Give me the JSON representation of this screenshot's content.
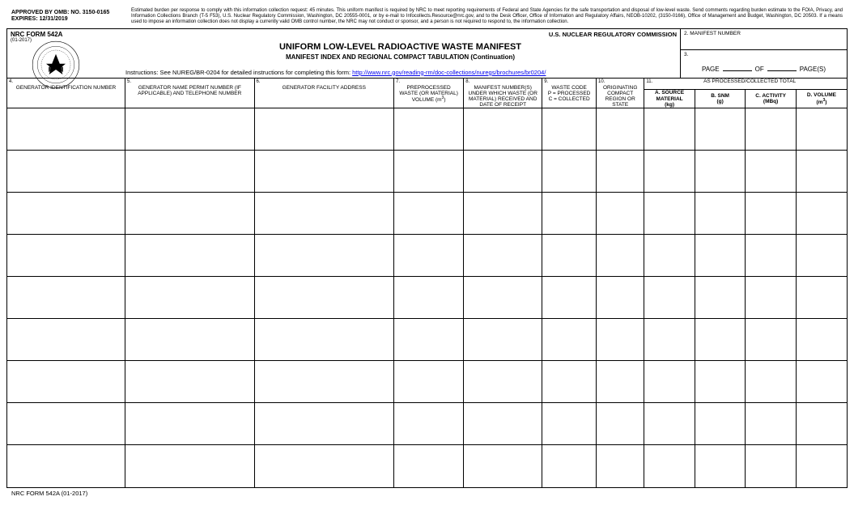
{
  "approval": {
    "line1": "APPROVED BY OMB:  NO.  3150-0165",
    "line2": "EXPIRES:  12/31/2019"
  },
  "burden_text": "Estimated burden per response to comply with this information collection request: 45 minutes.  This uniform manifest is required by NRC to meet reporting requirements of Federal and State Agencies for the safe transportation and disposal of low-level waste.  Send comments regarding burden estimate to the FOIA, Privacy, and Information Collections Branch (T-5 F53), U.S. Nuclear Regulatory Commission, Washington, DC  20555-0001, or by e-mail to Infocollects.Resource@nrc.gov, and to the Desk Officer, Office of Information and Regulatory Affairs, NEOB-10202, (3150-0166), Office of Management and Budget, Washington, DC  20503.  If a means used to impose an information collection does not display a currently valid OMB control number, the NRC may not conduct or sponsor, and a person is not required to respond to, the information collection.",
  "form": {
    "number": "NRC FORM 542A",
    "revision": "(01-2017)",
    "agency": "U.S. NUCLEAR REGULATORY COMMISSION",
    "title": "UNIFORM LOW-LEVEL RADIOACTIVE WASTE MANIFEST",
    "subtitle": "MANIFEST INDEX AND REGIONAL COMPACT TABULATION (Continuation)",
    "instructions_prefix": "Instructions:  See NUREG/BR-0204 for detailed instructions for completing this form:  ",
    "instructions_link": "http://www.nrc.gov/reading-rm/doc-collections/nuregs/brochures/br0204/"
  },
  "box2": {
    "num": "2.",
    "label": "MANIFEST NUMBER"
  },
  "box3": {
    "num": "3.",
    "page": "PAGE",
    "of": "OF",
    "pages": "PAGE(S)"
  },
  "columns": {
    "c4": {
      "num": "4.",
      "label": "GENERATOR IDENTIFICATION NUMBER"
    },
    "c5": {
      "num": "5.",
      "label": "GENERATOR NAME PERMIT NUMBER (IF APPLICABLE) AND TELEPHONE NUMBER"
    },
    "c6": {
      "num": "6.",
      "label": "GENERATOR FACILITY ADDRESS"
    },
    "c7": {
      "num": "7.",
      "label_html": "PREPROCESSED WASTE (OR MATERIAL) VOLUME (m³)"
    },
    "c8": {
      "num": "8.",
      "label": "MANIFEST NUMBER(S) UNDER WHICH WASTE (OR MATERIAL) RECEIVED AND DATE OF RECEIPT"
    },
    "c9": {
      "num": "9.",
      "label": "WASTE CODE P = PROCESSED C = COLLECTED"
    },
    "c10": {
      "num": "10.",
      "label": "ORIGINATING COMPACT REGION OR STATE"
    },
    "c11": {
      "num": "11.",
      "label": "AS PROCESSED/COLLECTED TOTAL",
      "a": "A.  SOURCE MATERIAL (kg)",
      "b": "B.  SNM (g)",
      "c": "C.  ACTIVITY (MBq)",
      "d_html": "D.  VOLUME (m³)"
    }
  },
  "footer": "NRC FORM 542A (01-2017)",
  "data_row_count": 9
}
